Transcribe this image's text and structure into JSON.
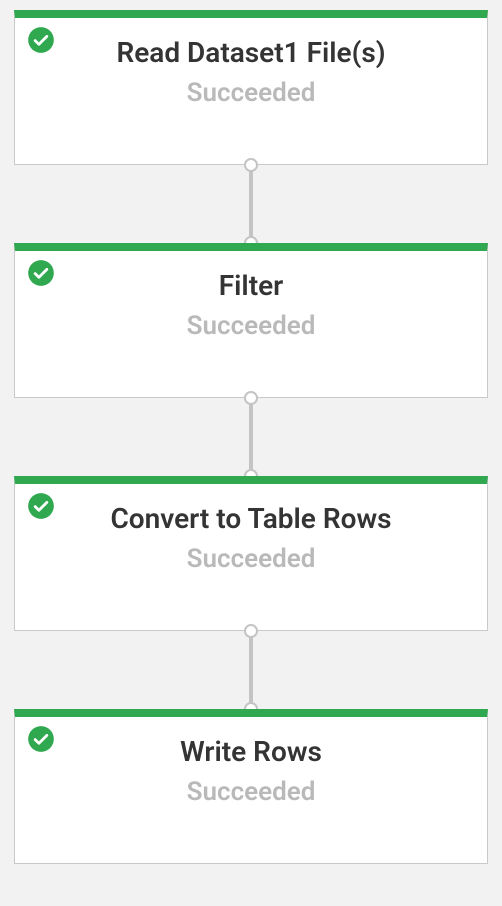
{
  "colors": {
    "success": "#2fa84f",
    "card_border": "#c9c9c9",
    "status_text": "#b9b9b9",
    "title_text": "#343434",
    "connector": "#c4c4c4",
    "canvas_bg": "#f2f2f2"
  },
  "status_label": "Succeeded",
  "icon_name": "check-circle-icon",
  "nodes": [
    {
      "title": "Read Dataset1 File(s)",
      "status": "Succeeded"
    },
    {
      "title": "Filter",
      "status": "Succeeded"
    },
    {
      "title": "Convert to Table Rows",
      "status": "Succeeded"
    },
    {
      "title": "Write Rows",
      "status": "Succeeded"
    }
  ]
}
